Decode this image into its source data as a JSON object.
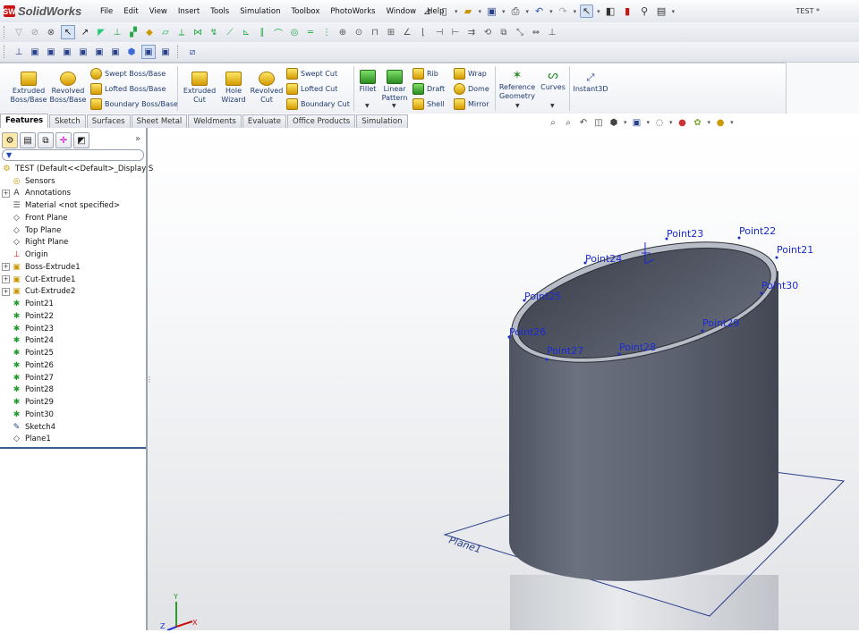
{
  "app": {
    "name": "SolidWorks",
    "logo_letters": "SW"
  },
  "menu": [
    "File",
    "Edit",
    "View",
    "Insert",
    "Tools",
    "Simulation",
    "Toolbox",
    "PhotoWorks",
    "Window",
    "Help"
  ],
  "document_title": "TEST *",
  "command_manager": {
    "extruded_boss": "Extruded\nBoss/Base",
    "revolved_boss": "Revolved\nBoss/Base",
    "swept_boss": "Swept Boss/Base",
    "lofted_boss": "Lofted Boss/Base",
    "boundary_boss": "Boundary Boss/Base",
    "extruded_cut": "Extruded\nCut",
    "hole_wizard": "Hole\nWizard",
    "revolved_cut": "Revolved\nCut",
    "swept_cut": "Swept Cut",
    "lofted_cut": "Lofted Cut",
    "boundary_cut": "Boundary Cut",
    "fillet": "Fillet",
    "linear_pattern": "Linear\nPattern",
    "rib": "Rib",
    "draft": "Draft",
    "shell": "Shell",
    "wrap": "Wrap",
    "dome": "Dome",
    "mirror": "Mirror",
    "reference_geometry": "Reference\nGeometry",
    "curves": "Curves",
    "instant3d": "Instant3D"
  },
  "tabs": [
    "Features",
    "Sketch",
    "Surfaces",
    "Sheet Metal",
    "Weldments",
    "Evaluate",
    "Office Products",
    "Simulation"
  ],
  "active_tab": "Features",
  "tree": {
    "root": "TEST  (Default<<Default>_Display S",
    "items": [
      {
        "label": "Sensors",
        "icon": "sensor-icon",
        "expand": ""
      },
      {
        "label": "Annotations",
        "icon": "annotations-icon",
        "expand": "+"
      },
      {
        "label": "Material <not specified>",
        "icon": "material-icon",
        "expand": ""
      },
      {
        "label": "Front Plane",
        "icon": "plane-icon",
        "expand": ""
      },
      {
        "label": "Top Plane",
        "icon": "plane-icon",
        "expand": ""
      },
      {
        "label": "Right Plane",
        "icon": "plane-icon",
        "expand": ""
      },
      {
        "label": "Origin",
        "icon": "origin-icon",
        "expand": ""
      },
      {
        "label": "Boss-Extrude1",
        "icon": "boss-extrude-icon",
        "expand": "+"
      },
      {
        "label": "Cut-Extrude1",
        "icon": "cut-extrude-icon",
        "expand": "+"
      },
      {
        "label": "Cut-Extrude2",
        "icon": "cut-extrude-icon",
        "expand": "+"
      },
      {
        "label": "Point21",
        "icon": "point-icon",
        "expand": ""
      },
      {
        "label": "Point22",
        "icon": "point-icon",
        "expand": ""
      },
      {
        "label": "Point23",
        "icon": "point-icon",
        "expand": ""
      },
      {
        "label": "Point24",
        "icon": "point-icon",
        "expand": ""
      },
      {
        "label": "Point25",
        "icon": "point-icon",
        "expand": ""
      },
      {
        "label": "Point26",
        "icon": "point-icon",
        "expand": ""
      },
      {
        "label": "Point27",
        "icon": "point-icon",
        "expand": ""
      },
      {
        "label": "Point28",
        "icon": "point-icon",
        "expand": ""
      },
      {
        "label": "Point29",
        "icon": "point-icon",
        "expand": ""
      },
      {
        "label": "Point30",
        "icon": "point-icon",
        "expand": ""
      },
      {
        "label": "Sketch4",
        "icon": "sketch-icon",
        "expand": ""
      },
      {
        "label": "Plane1",
        "icon": "plane-icon",
        "expand": ""
      }
    ]
  },
  "viewport": {
    "points": [
      "Point21",
      "Point22",
      "Point23",
      "Point24",
      "Point25",
      "Point26",
      "Point27",
      "Point28",
      "Point29",
      "Point30"
    ],
    "plane_label": "Plane1",
    "axes": {
      "x": "X",
      "y": "Y",
      "z": "Z"
    }
  },
  "colors": {
    "accent": "#1a2bd4",
    "tree_point": "#1f9b2c",
    "part": "#5f6472"
  }
}
